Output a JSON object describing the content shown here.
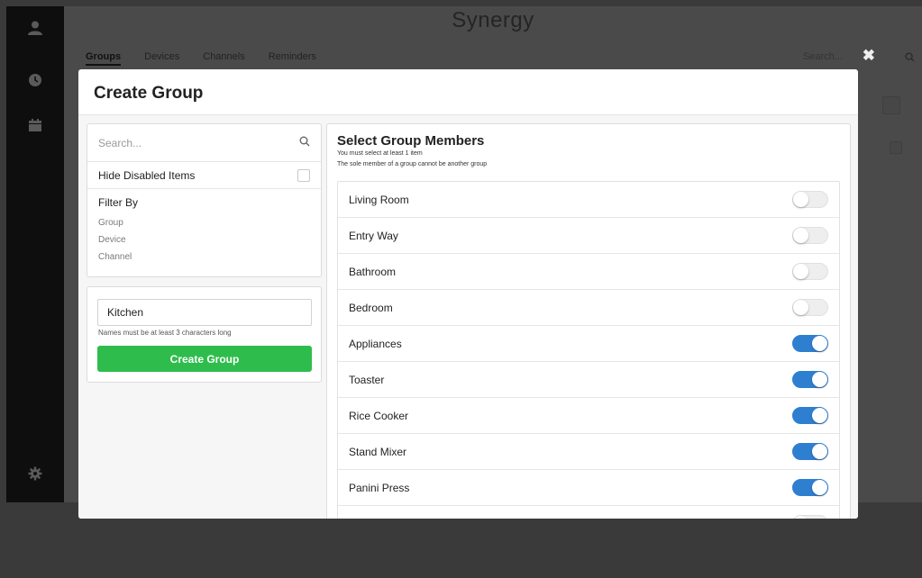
{
  "app": {
    "title": "Synergy",
    "tabs": [
      {
        "label": "Groups",
        "active": true
      },
      {
        "label": "Devices",
        "active": false
      },
      {
        "label": "Channels",
        "active": false
      },
      {
        "label": "Reminders",
        "active": false
      }
    ],
    "search_placeholder": "Search..."
  },
  "sidebar": {
    "icons": [
      "user-icon",
      "clock-icon",
      "calendar-icon",
      "gear-icon"
    ]
  },
  "modal": {
    "title": "Create Group",
    "filter": {
      "search_placeholder": "Search...",
      "hide_disabled_label": "Hide Disabled Items",
      "hide_disabled_checked": false,
      "filter_by_label": "Filter By",
      "options": [
        "Group",
        "Device",
        "Channel"
      ]
    },
    "name_form": {
      "name_value": "Kitchen",
      "hint": "Names must be at least 3 characters long",
      "create_label": "Create Group"
    },
    "members": {
      "title": "Select Group Members",
      "subtitle1": "You must select at least 1 item",
      "subtitle2": "The sole member of a group cannot be another group",
      "items": [
        {
          "label": "Living Room",
          "on": false
        },
        {
          "label": "Entry Way",
          "on": false
        },
        {
          "label": "Bathroom",
          "on": false
        },
        {
          "label": "Bedroom",
          "on": false
        },
        {
          "label": "Appliances",
          "on": true
        },
        {
          "label": "Toaster",
          "on": true
        },
        {
          "label": "Rice Cooker",
          "on": true
        },
        {
          "label": "Stand Mixer",
          "on": true
        },
        {
          "label": "Panini Press",
          "on": true
        },
        {
          "label": "",
          "on": false
        }
      ]
    }
  },
  "colors": {
    "accent_green": "#2ebd4c",
    "toggle_on": "#2f7fd0",
    "sidebar": "#0e0e0e"
  }
}
